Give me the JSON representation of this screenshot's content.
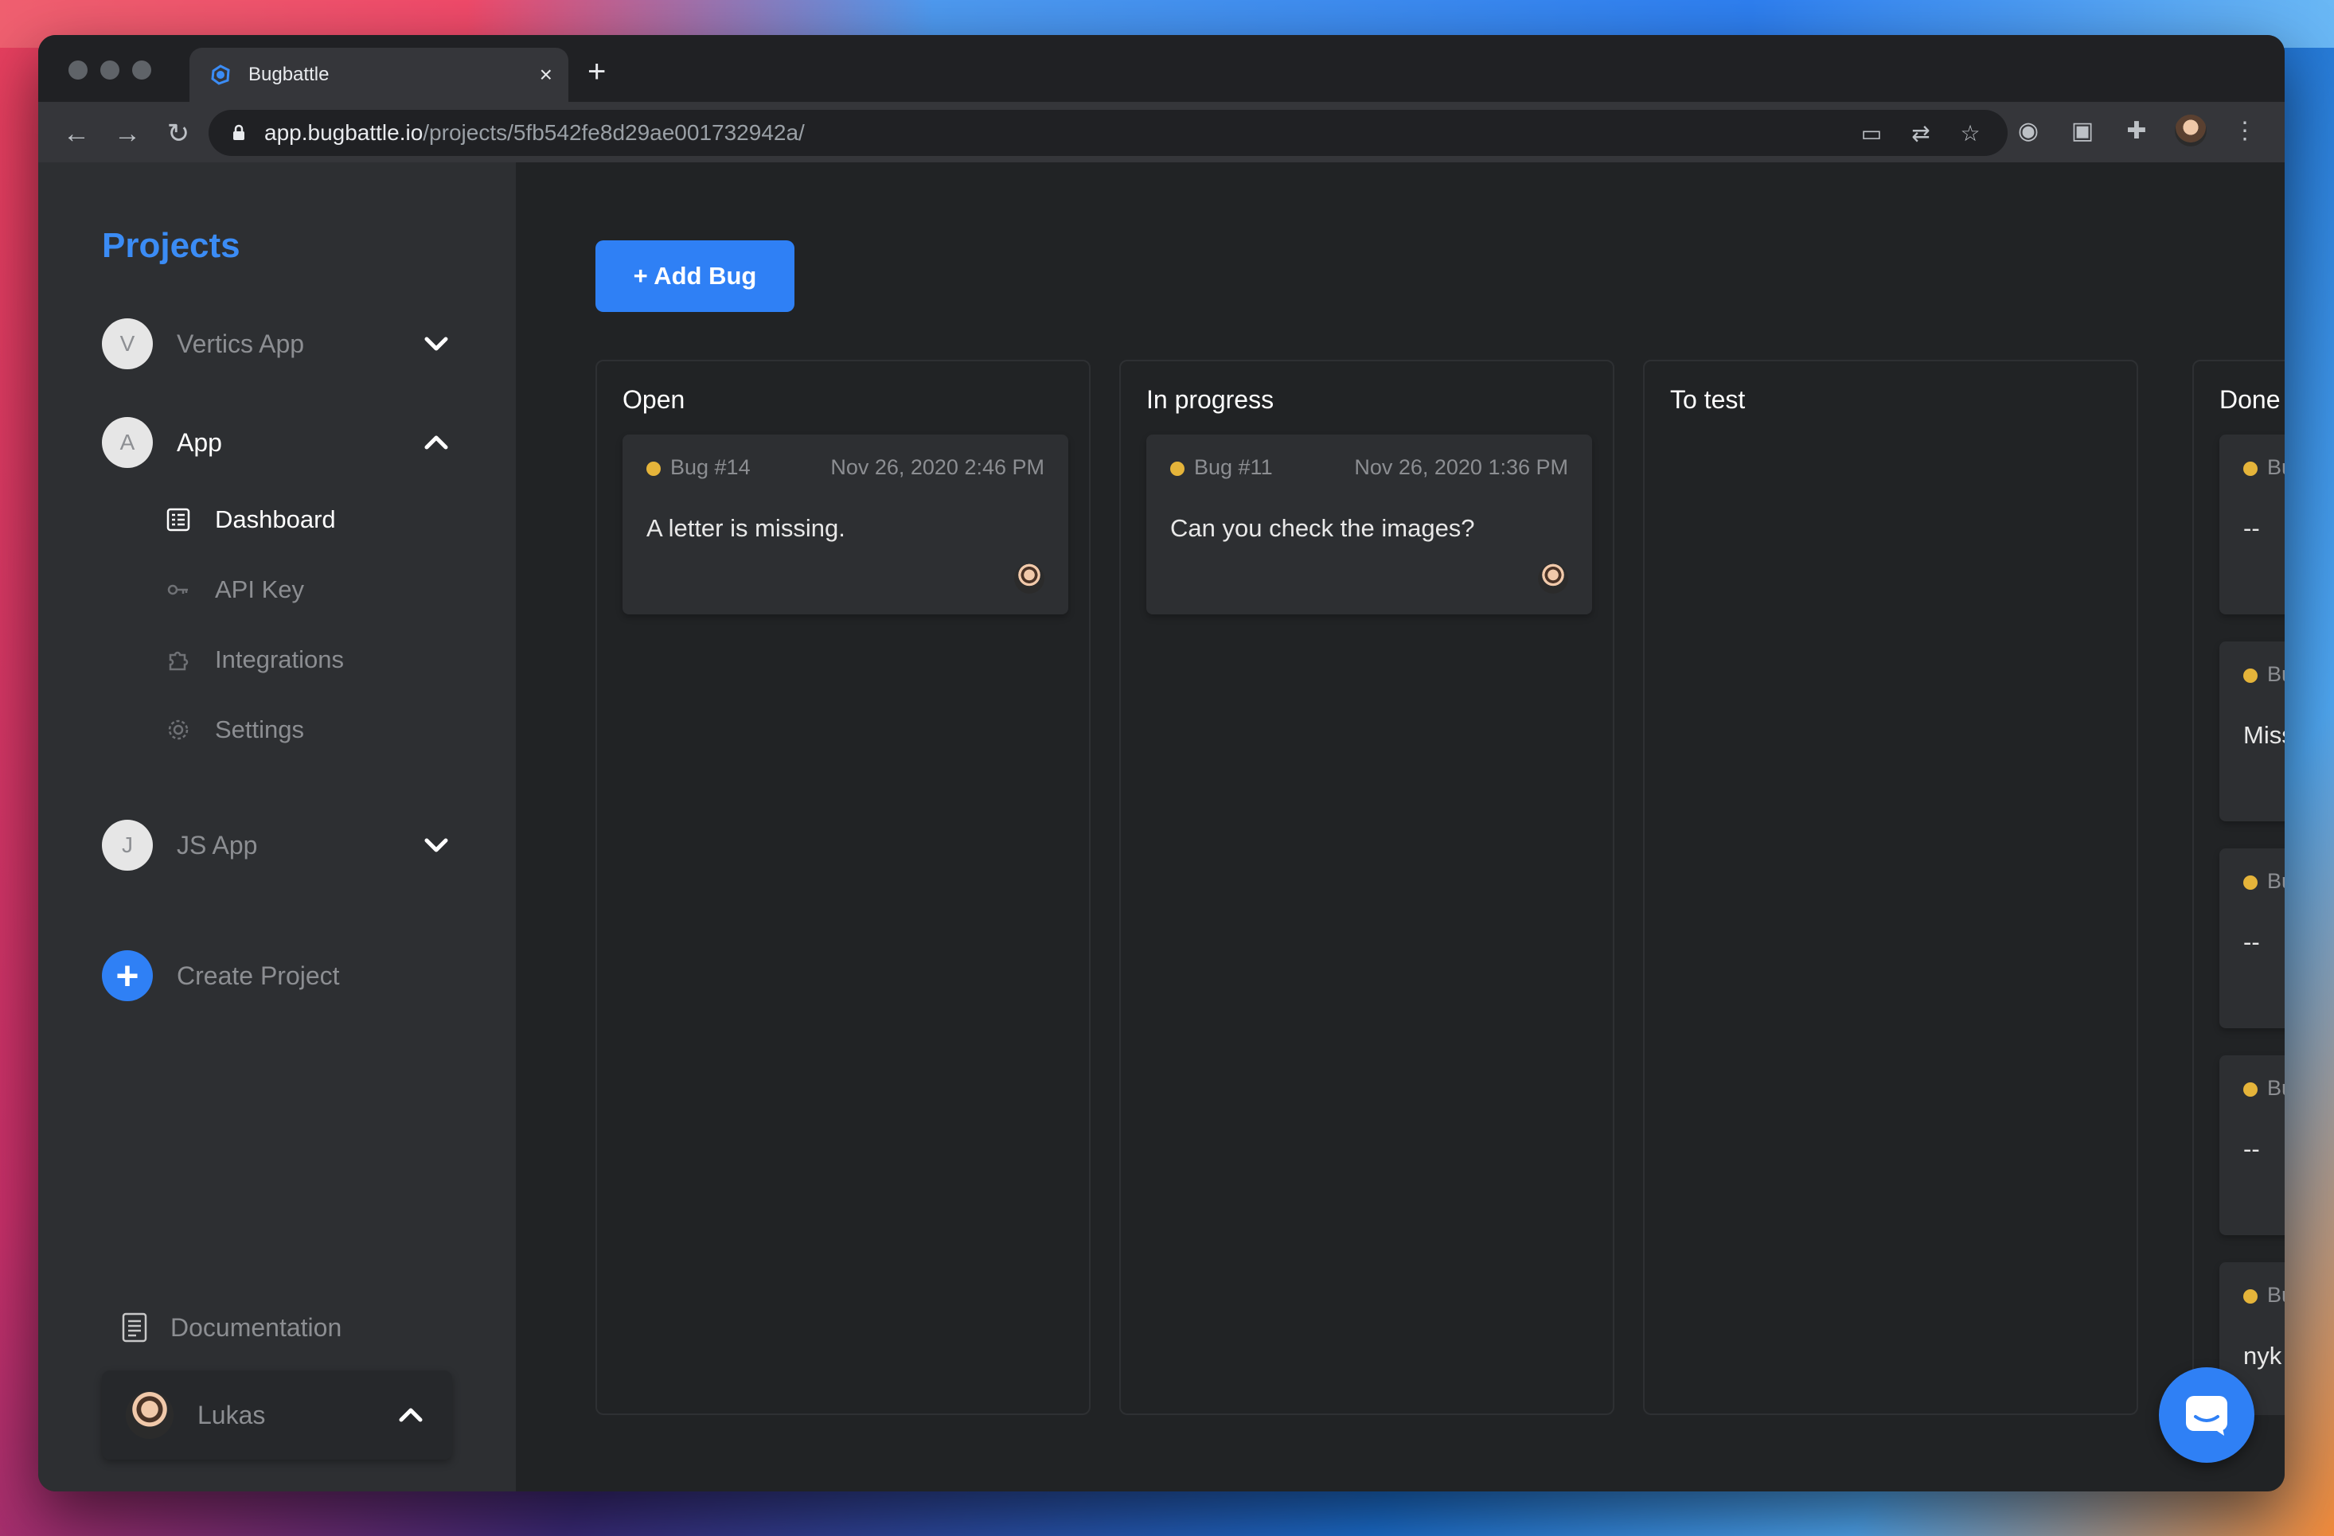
{
  "browser": {
    "tab_title": "Bugbattle",
    "url_host": "app.bugbattle.io",
    "url_path": "/projects/5fb542fe8d29ae001732942a/"
  },
  "sidebar": {
    "title": "Projects",
    "projects": [
      {
        "letter": "V",
        "name": "Vertics App",
        "expanded": false
      },
      {
        "letter": "A",
        "name": "App",
        "expanded": true
      },
      {
        "letter": "J",
        "name": "JS App",
        "expanded": false
      }
    ],
    "subitems": [
      {
        "label": "Dashboard",
        "icon": "dashboard-icon",
        "active": true
      },
      {
        "label": "API Key",
        "icon": "key-icon",
        "active": false
      },
      {
        "label": "Integrations",
        "icon": "puzzle-icon",
        "active": false
      },
      {
        "label": "Settings",
        "icon": "gear-icon",
        "active": false
      }
    ],
    "create_project": "Create Project",
    "documentation": "Documentation",
    "user": "Lukas"
  },
  "main": {
    "add_bug_label": "+ Add Bug",
    "columns": [
      {
        "title": "Open",
        "cards": [
          {
            "id": "Bug #14",
            "date": "Nov 26, 2020 2:46 PM",
            "desc": "A letter is missing."
          }
        ]
      },
      {
        "title": "In progress",
        "cards": [
          {
            "id": "Bug #11",
            "date": "Nov 26, 2020 1:36 PM",
            "desc": "Can you check the images?"
          }
        ]
      },
      {
        "title": "To test",
        "cards": []
      },
      {
        "title": "Done",
        "cards": [
          {
            "id": "Bug",
            "desc": "--"
          },
          {
            "id": "Bug",
            "desc": "Missir"
          },
          {
            "id": "Bug",
            "desc": "--"
          },
          {
            "id": "Bug",
            "desc": "--"
          },
          {
            "id": "Bug",
            "desc": "nyk"
          }
        ]
      }
    ]
  },
  "colors": {
    "accent": "#2f80f5",
    "status_dot": "#e5b43a",
    "sidebar_bg": "#2d2f32",
    "main_bg": "#212325"
  }
}
